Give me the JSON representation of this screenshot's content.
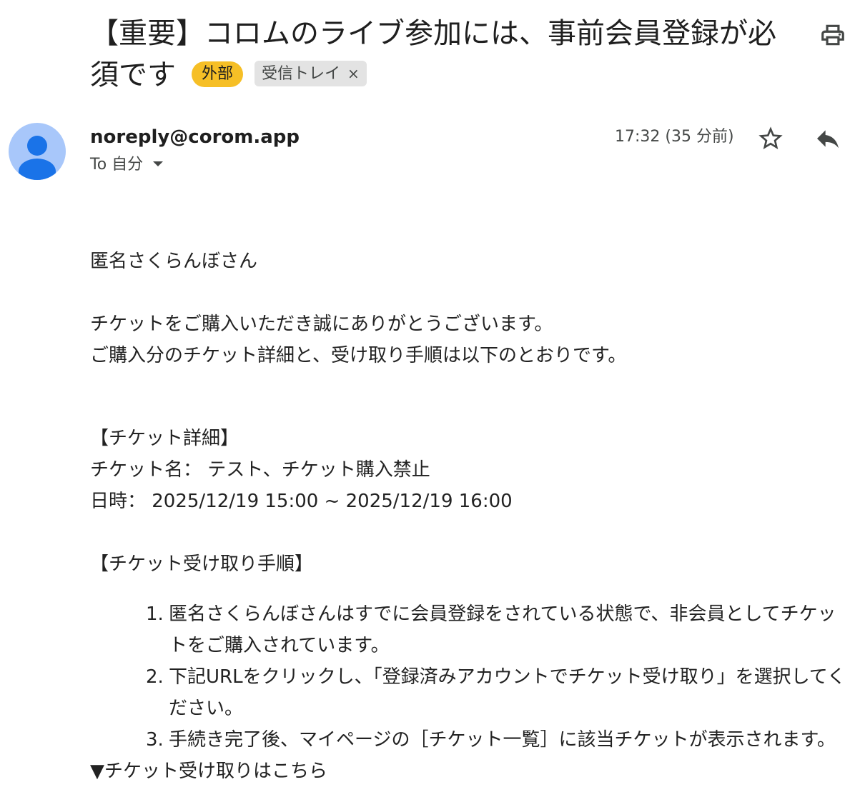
{
  "header": {
    "subject": "【重要】コロムのライブ参加には、事前会員登録が必須です",
    "labels": {
      "external": "外部",
      "inbox": "受信トレイ",
      "inbox_close": "×"
    }
  },
  "message": {
    "sender": "noreply@corom.app",
    "recipient": "To 自分",
    "timestamp": "17:32 (35 分前)"
  },
  "body": {
    "greeting": "匿名さくらんぼさん",
    "thanks_line1": "チケットをご購入いただき誠にありがとうございます。",
    "thanks_line2": "ご購入分のチケット詳細と、受け取り手順は以下のとおりです。",
    "details_heading": "【チケット詳細】",
    "ticket_name": "チケット名： テスト、チケット購入禁止",
    "datetime": "日時： 2025/12/19 15:00 ~ 2025/12/19 16:00",
    "steps_heading": "【チケット受け取り手順】",
    "steps": [
      {
        "num": "1.",
        "line1": "匿名さくらんぼさんはすでに会員登録をされている状態で、非会員としてチケッ",
        "line2": "トをご購入されています。"
      },
      {
        "num": "2.",
        "line1": "下記URLをクリックし、「登録済みアカウントでチケット受け取り」を選択してく",
        "line2": "ださい。"
      },
      {
        "num": "3.",
        "line1": "手続き完了後、マイページの［チケット一覧］に該当チケットが表示されます。",
        "line2": ""
      }
    ],
    "link_heading": "▼チケット受け取りはこちら"
  },
  "icons": {
    "print": "printer-icon",
    "star": "star-outline-icon",
    "reply": "reply-arrow-icon",
    "avatar": "default-person-avatar",
    "caret": "caret-down-icon"
  },
  "colors": {
    "external_chip": "#f6bf26",
    "inbox_chip": "#e3e3e3",
    "avatar_bg": "#a8c7fa",
    "avatar_person": "#1a73e8"
  }
}
